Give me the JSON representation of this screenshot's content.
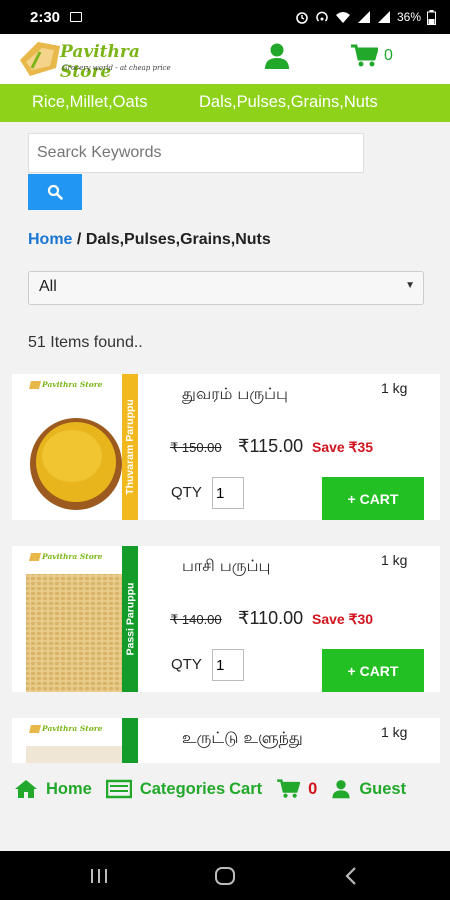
{
  "status_bar": {
    "time": "2:30",
    "battery": "36%"
  },
  "header": {
    "logo": {
      "brand": "Pavithra Store",
      "tagline": "Grocery world - at cheap price"
    },
    "cart_count": "0"
  },
  "categories": [
    "Rice,Millet,Oats",
    "Dals,Pulses,Grains,Nuts"
  ],
  "search": {
    "placeholder": "Searck Keywords"
  },
  "breadcrumb": {
    "home": "Home",
    "separator": "/",
    "current": "Dals,Pulses,Grains,Nuts"
  },
  "filter": {
    "selected": "All"
  },
  "result_count": "51 Items found..",
  "products": [
    {
      "name": "துவரம் பருப்பு",
      "weight": "1 kg",
      "mrp": "₹ 150.00",
      "price": "₹115.00",
      "save": "Save ₹35",
      "qty_label": "QTY",
      "qty": "1",
      "button": "+ CART",
      "thumb_label": "Thuvaram Paruppu",
      "label_color": "#f2b91e",
      "brand": "Pavithra Store"
    },
    {
      "name": "பாசி பருப்பு",
      "weight": "1 kg",
      "mrp": "₹ 140.00",
      "price": "₹110.00",
      "save": "Save ₹30",
      "qty_label": "QTY",
      "qty": "1",
      "button": "+ CART",
      "thumb_label": "Passi Paruppu",
      "label_color": "#149c2a",
      "brand": "Pavithra Store"
    },
    {
      "name": "உருட்டு உளுந்து",
      "weight": "1 kg",
      "label_color": "#149c2a",
      "brand": "Pavithra Store"
    }
  ],
  "bottom_nav": {
    "home": "Home",
    "categories": "Categories",
    "cart": "Cart",
    "cart_count": "0",
    "guest": "Guest"
  },
  "colors": {
    "green": "#22a82a",
    "category_bar": "#8ed21a",
    "search_button": "#2196f3",
    "save_red": "#d0141e"
  }
}
